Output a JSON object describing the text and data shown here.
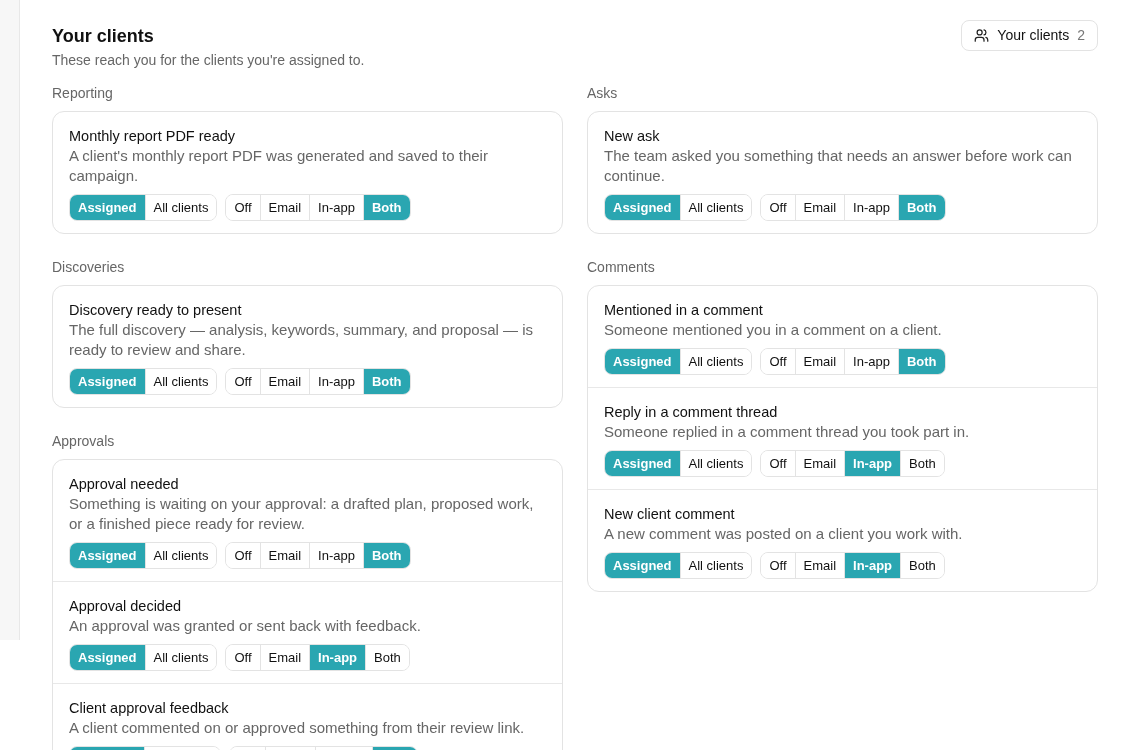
{
  "header": {
    "title": "Your clients",
    "subtitle": "These reach you for the clients you're assigned to.",
    "badge": {
      "label": "Your clients",
      "count": "2"
    }
  },
  "columns": [
    {
      "sections": [
        {
          "label": "Reporting",
          "items": [
            {
              "title": "Monthly report PDF ready",
              "description": "A client's monthly report PDF was generated and saved to their campaign.",
              "scope": [
                {
                  "label": "Assigned",
                  "selected": true
                },
                {
                  "label": "All clients",
                  "selected": false
                }
              ],
              "channel": [
                {
                  "label": "Off",
                  "selected": false
                },
                {
                  "label": "Email",
                  "selected": false
                },
                {
                  "label": "In-app",
                  "selected": false
                },
                {
                  "label": "Both",
                  "selected": true
                }
              ]
            }
          ]
        },
        {
          "label": "Discoveries",
          "items": [
            {
              "title": "Discovery ready to present",
              "description": "The full discovery — analysis, keywords, summary, and proposal — is ready to review and share.",
              "scope": [
                {
                  "label": "Assigned",
                  "selected": true
                },
                {
                  "label": "All clients",
                  "selected": false
                }
              ],
              "channel": [
                {
                  "label": "Off",
                  "selected": false
                },
                {
                  "label": "Email",
                  "selected": false
                },
                {
                  "label": "In-app",
                  "selected": false
                },
                {
                  "label": "Both",
                  "selected": true
                }
              ]
            }
          ]
        },
        {
          "label": "Approvals",
          "items": [
            {
              "title": "Approval needed",
              "description": "Something is waiting on your approval: a drafted plan, proposed work, or a finished piece ready for review.",
              "scope": [
                {
                  "label": "Assigned",
                  "selected": true
                },
                {
                  "label": "All clients",
                  "selected": false
                }
              ],
              "channel": [
                {
                  "label": "Off",
                  "selected": false
                },
                {
                  "label": "Email",
                  "selected": false
                },
                {
                  "label": "In-app",
                  "selected": false
                },
                {
                  "label": "Both",
                  "selected": true
                }
              ]
            },
            {
              "title": "Approval decided",
              "description": "An approval was granted or sent back with feedback.",
              "scope": [
                {
                  "label": "Assigned",
                  "selected": true
                },
                {
                  "label": "All clients",
                  "selected": false
                }
              ],
              "channel": [
                {
                  "label": "Off",
                  "selected": false
                },
                {
                  "label": "Email",
                  "selected": false
                },
                {
                  "label": "In-app",
                  "selected": true
                },
                {
                  "label": "Both",
                  "selected": false
                }
              ]
            },
            {
              "title": "Client approval feedback",
              "description": "A client commented on or approved something from their review link.",
              "scope": [
                {
                  "selected": true
                },
                {
                  "selected": false
                }
              ],
              "channel": [
                {
                  "selected": false
                },
                {
                  "selected": false
                },
                {
                  "selected": false
                },
                {
                  "selected": true
                }
              ]
            }
          ]
        }
      ]
    },
    {
      "sections": [
        {
          "label": "Asks",
          "items": [
            {
              "title": "New ask",
              "description": "The team asked you something that needs an answer before work can continue.",
              "scope": [
                {
                  "label": "Assigned",
                  "selected": true
                },
                {
                  "label": "All clients",
                  "selected": false
                }
              ],
              "channel": [
                {
                  "label": "Off",
                  "selected": false
                },
                {
                  "label": "Email",
                  "selected": false
                },
                {
                  "label": "In-app",
                  "selected": false
                },
                {
                  "label": "Both",
                  "selected": true
                }
              ]
            }
          ]
        },
        {
          "label": "Comments",
          "items": [
            {
              "title": "Mentioned in a comment",
              "description": "Someone mentioned you in a comment on a client.",
              "scope": [
                {
                  "label": "Assigned",
                  "selected": true
                },
                {
                  "label": "All clients",
                  "selected": false
                }
              ],
              "channel": [
                {
                  "label": "Off",
                  "selected": false
                },
                {
                  "label": "Email",
                  "selected": false
                },
                {
                  "label": "In-app",
                  "selected": false
                },
                {
                  "label": "Both",
                  "selected": true
                }
              ]
            },
            {
              "title": "Reply in a comment thread",
              "description": "Someone replied in a comment thread you took part in.",
              "scope": [
                {
                  "label": "Assigned",
                  "selected": true
                },
                {
                  "label": "All clients",
                  "selected": false
                }
              ],
              "channel": [
                {
                  "label": "Off",
                  "selected": false
                },
                {
                  "label": "Email",
                  "selected": false
                },
                {
                  "label": "In-app",
                  "selected": true
                },
                {
                  "label": "Both",
                  "selected": false
                }
              ]
            },
            {
              "title": "New client comment",
              "description": "A new comment was posted on a client you work with.",
              "scope": [
                {
                  "label": "Assigned",
                  "selected": true
                },
                {
                  "label": "All clients",
                  "selected": false
                }
              ],
              "channel": [
                {
                  "label": "Off",
                  "selected": false
                },
                {
                  "label": "Email",
                  "selected": false
                },
                {
                  "label": "In-app",
                  "selected": true
                },
                {
                  "label": "Both",
                  "selected": false
                }
              ]
            }
          ]
        }
      ]
    }
  ]
}
